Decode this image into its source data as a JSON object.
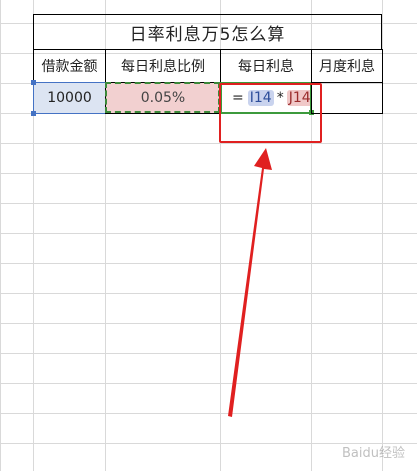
{
  "title": "日率利息万5怎么算",
  "headers": [
    "借款金额",
    "每日利息比例",
    "每日利息",
    "月度利息"
  ],
  "row": {
    "amount": "10000",
    "ratio": "0.05%",
    "formula": {
      "prefix": "=",
      "ref1": "I14",
      "operator": "*",
      "ref2": "J14"
    },
    "monthly": ""
  },
  "colors": {
    "annotation_red": "#e02020",
    "ratio_fill": "#f2d0d0",
    "amount_fill": "#dce4f2",
    "edit_green": "#3c9a3c"
  },
  "watermark": "Baidu经验"
}
